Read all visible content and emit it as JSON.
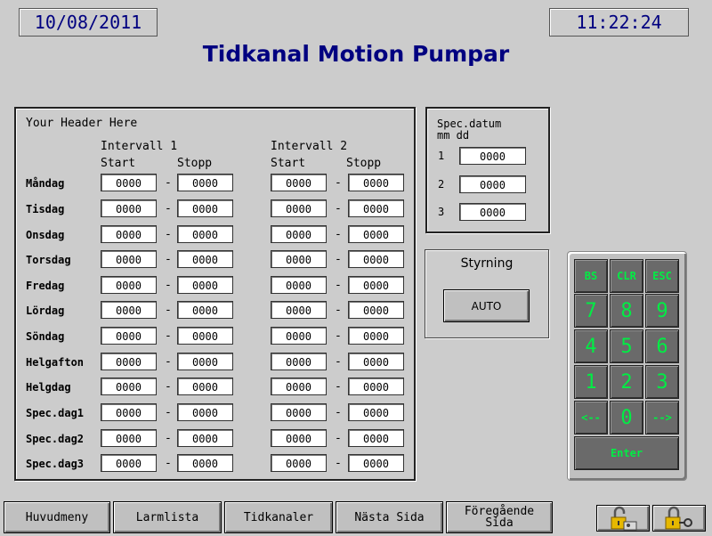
{
  "header": {
    "date": "10/08/2011",
    "time": "11:22:24",
    "title": "Tidkanal Motion Pumpar"
  },
  "schedule": {
    "header_text": "Your Header Here",
    "interval1_label": "Intervall 1",
    "interval2_label": "Intervall 2",
    "start_label": "Start",
    "stop_label": "Stopp",
    "dash": "-",
    "rows": [
      {
        "day": "Måndag",
        "i1_start": "0000",
        "i1_stop": "0000",
        "i2_start": "0000",
        "i2_stop": "0000"
      },
      {
        "day": "Tisdag",
        "i1_start": "0000",
        "i1_stop": "0000",
        "i2_start": "0000",
        "i2_stop": "0000"
      },
      {
        "day": "Onsdag",
        "i1_start": "0000",
        "i1_stop": "0000",
        "i2_start": "0000",
        "i2_stop": "0000"
      },
      {
        "day": "Torsdag",
        "i1_start": "0000",
        "i1_stop": "0000",
        "i2_start": "0000",
        "i2_stop": "0000"
      },
      {
        "day": "Fredag",
        "i1_start": "0000",
        "i1_stop": "0000",
        "i2_start": "0000",
        "i2_stop": "0000"
      },
      {
        "day": "Lördag",
        "i1_start": "0000",
        "i1_stop": "0000",
        "i2_start": "0000",
        "i2_stop": "0000"
      },
      {
        "day": "Söndag",
        "i1_start": "0000",
        "i1_stop": "0000",
        "i2_start": "0000",
        "i2_stop": "0000"
      },
      {
        "day": "Helgafton",
        "i1_start": "0000",
        "i1_stop": "0000",
        "i2_start": "0000",
        "i2_stop": "0000"
      },
      {
        "day": "Helgdag",
        "i1_start": "0000",
        "i1_stop": "0000",
        "i2_start": "0000",
        "i2_stop": "0000"
      },
      {
        "day": "Spec.dag1",
        "i1_start": "0000",
        "i1_stop": "0000",
        "i2_start": "0000",
        "i2_stop": "0000"
      },
      {
        "day": "Spec.dag2",
        "i1_start": "0000",
        "i1_stop": "0000",
        "i2_start": "0000",
        "i2_stop": "0000"
      },
      {
        "day": "Spec.dag3",
        "i1_start": "0000",
        "i1_stop": "0000",
        "i2_start": "0000",
        "i2_stop": "0000"
      }
    ]
  },
  "spec_datum": {
    "title_line1": "Spec.datum",
    "title_line2": "mm dd",
    "entries": [
      {
        "index": "1",
        "value": "0000"
      },
      {
        "index": "2",
        "value": "0000"
      },
      {
        "index": "3",
        "value": "0000"
      }
    ]
  },
  "styrning": {
    "title": "Styrning",
    "mode_button": "AUTO"
  },
  "keypad": {
    "keys": [
      "BS",
      "CLR",
      "ESC",
      "7",
      "8",
      "9",
      "4",
      "5",
      "6",
      "1",
      "2",
      "3",
      "<--",
      "0",
      "-->"
    ],
    "enter": "Enter",
    "key_color": "#00ee44"
  },
  "bottom_nav": {
    "huvudmeny": "Huvudmeny",
    "larmlista": "Larmlista",
    "tidkanaler": "Tidkanaler",
    "nasta_sida": "Nästa Sida",
    "foregaende_line1": "Föregående",
    "foregaende_line2": "Sida",
    "login_icon": "lock-open-icon",
    "logout_icon": "lock-key-icon"
  },
  "colors": {
    "background": "#cccccc",
    "title_blue": "#000080",
    "keypad_gray": "#6a6a6a"
  }
}
